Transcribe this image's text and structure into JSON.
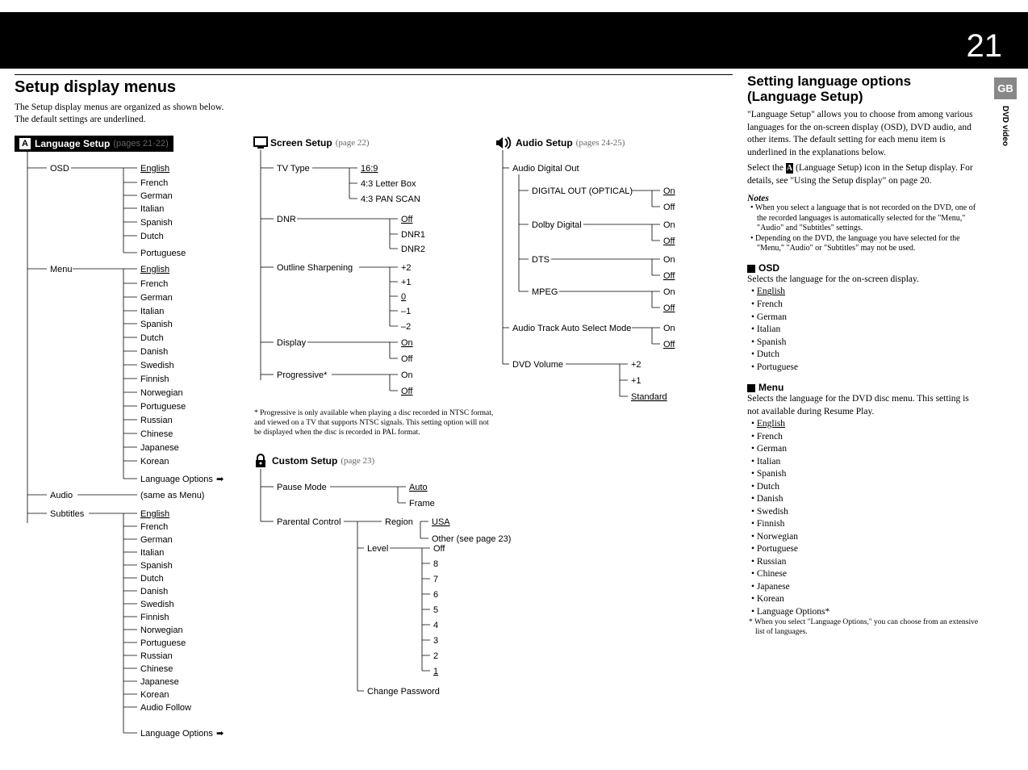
{
  "page_number": "21",
  "side": {
    "gb": "GB",
    "dvd": "DVD video"
  },
  "left": {
    "title": "Setup display menus",
    "intro1": "The Setup display menus are organized as shown below.",
    "intro2": "The default settings are underlined.",
    "lang": {
      "title": "Language Setup",
      "pages": "(pages 21-22)",
      "osd": {
        "label": "OSD",
        "items": [
          "English",
          "French",
          "German",
          "Italian",
          "Spanish",
          "Dutch",
          "Portuguese"
        ],
        "default": "English"
      },
      "menu": {
        "label": "Menu",
        "items": [
          "English",
          "French",
          "German",
          "Italian",
          "Spanish",
          "Dutch",
          "Danish",
          "Swedish",
          "Finnish",
          "Norwegian",
          "Portuguese",
          "Russian",
          "Chinese",
          "Japanese",
          "Korean",
          "Language Options"
        ],
        "default": "English"
      },
      "audio": {
        "label": "Audio",
        "val": "(same as Menu)"
      },
      "subtitles": {
        "label": "Subtitles",
        "items": [
          "English",
          "French",
          "German",
          "Italian",
          "Spanish",
          "Dutch",
          "Danish",
          "Swedish",
          "Finnish",
          "Norwegian",
          "Portuguese",
          "Russian",
          "Chinese",
          "Japanese",
          "Korean",
          "Audio Follow",
          "Language Options"
        ],
        "default": "English"
      }
    },
    "screen": {
      "title": "Screen Setup",
      "pages": "(page 22)",
      "tvtype": {
        "label": "TV Type",
        "items": [
          "16:9",
          "4:3 Letter Box",
          "4:3 PAN SCAN"
        ],
        "default": "16:9"
      },
      "dnr": {
        "label": "DNR",
        "items": [
          "Off",
          "DNR1",
          "DNR2"
        ],
        "default": "Off"
      },
      "outline": {
        "label": "Outline Sharpening",
        "items": [
          "+2",
          "+1",
          "0",
          "–1",
          "–2"
        ],
        "default": "0"
      },
      "display": {
        "label": "Display",
        "items": [
          "On",
          "Off"
        ],
        "default": "On"
      },
      "progressive": {
        "label": "Progressive*",
        "items": [
          "On",
          "Off"
        ],
        "default": "Off"
      },
      "footnote": "* Progressive is only available when playing a disc recorded in NTSC format, and viewed on a TV that supports NTSC signals. This setting option will not be displayed when the disc is recorded in PAL format."
    },
    "custom": {
      "title": "Custom Setup",
      "pages": "(page 23)",
      "pause": {
        "label": "Pause Mode",
        "items": [
          "Auto",
          "Frame"
        ],
        "default": "Auto"
      },
      "parental": {
        "label": "Parental Control",
        "region": {
          "label": "Region",
          "items": [
            "USA",
            "Other (see page 23)"
          ],
          "default": "USA"
        },
        "level": {
          "label": "Level",
          "items": [
            "Off",
            "8",
            "7",
            "6",
            "5",
            "4",
            "3",
            "2",
            "1"
          ],
          "default": "1"
        },
        "change": "Change Password"
      }
    },
    "audio": {
      "title": "Audio Setup",
      "pages": "(pages 24-25)",
      "digital": {
        "label": "Audio Digital Out",
        "optical": {
          "label": "DIGITAL OUT (OPTICAL)",
          "items": [
            "On",
            "Off"
          ],
          "default": "On"
        },
        "dolby": {
          "label": "Dolby Digital",
          "items": [
            "On",
            "Off"
          ],
          "default": "Off"
        },
        "dts": {
          "label": "DTS",
          "items": [
            "On",
            "Off"
          ],
          "default": "Off"
        },
        "mpeg": {
          "label": "MPEG",
          "items": [
            "On",
            "Off"
          ],
          "default": "Off"
        }
      },
      "auto": {
        "label": "Audio Track Auto Select Mode",
        "items": [
          "On",
          "Off"
        ],
        "default": "Off"
      },
      "volume": {
        "label": "DVD Volume",
        "items": [
          "+2",
          "+1",
          "Standard"
        ],
        "default": "Standard"
      }
    }
  },
  "right": {
    "title": "Setting language options (Language Setup)",
    "p1": "\"Language Setup\" allows you to choose from among various languages for the on-screen display (OSD), DVD audio, and other items. The default setting for each menu item is underlined in the explanations below.",
    "p2a": "Select the ",
    "p2b": " (Language Setup) icon in the Setup display. For details, see \"Using the Setup display\" on page 20.",
    "notes": "Notes",
    "n1": "When you select a language that is not recorded on the DVD, one of the recorded languages is automatically selected for the \"Menu,\" \"Audio\" and \"Subtitles\" settings.",
    "n2": "Depending on the DVD, the language you have selected for the \"Menu,\" \"Audio\" or \"Subtitles\" may not be used.",
    "osd": {
      "head": "OSD",
      "desc": "Selects the language for the on-screen display.",
      "items": [
        "English",
        "French",
        "German",
        "Italian",
        "Spanish",
        "Dutch",
        "Portuguese"
      ],
      "default": "English"
    },
    "menu": {
      "head": "Menu",
      "desc": "Selects the language for the DVD disc menu. This setting is not available during Resume Play.",
      "items": [
        "English",
        "French",
        "German",
        "Italian",
        "Spanish",
        "Dutch",
        "Danish",
        "Swedish",
        "Finnish",
        "Norwegian",
        "Portuguese",
        "Russian",
        "Chinese",
        "Japanese",
        "Korean",
        "Language Options*"
      ],
      "default": "English"
    },
    "ast": "* When you select \"Language Options,\" you can choose from an extensive list of languages."
  }
}
